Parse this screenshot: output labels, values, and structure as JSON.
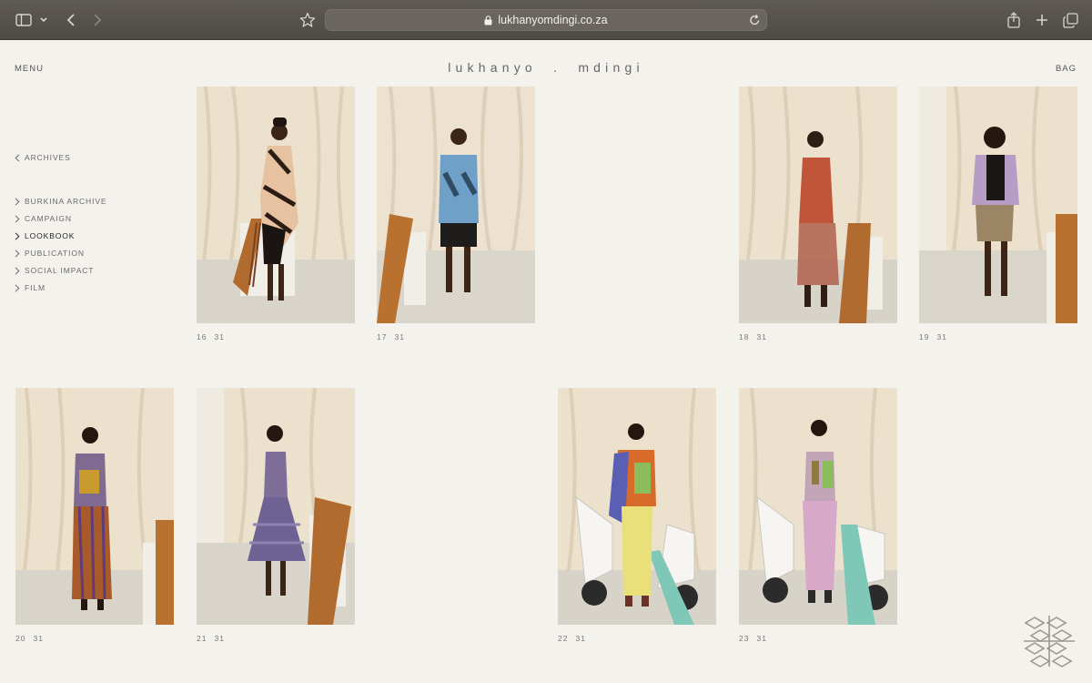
{
  "browser": {
    "url": "lukhanyomdingi.co.za"
  },
  "header": {
    "menu": "MENU",
    "logo": "lukhanyo  .  mdingi",
    "bag": "BAG"
  },
  "sidenav": {
    "back": "ARCHIVES",
    "items": [
      {
        "label": "BURKINA ARCHIVE"
      },
      {
        "label": "CAMPAIGN"
      },
      {
        "label": "LOOKBOOK",
        "active": true
      },
      {
        "label": "PUBLICATION"
      },
      {
        "label": "SOCIAL IMPACT"
      },
      {
        "label": "FILM"
      }
    ]
  },
  "gallery": {
    "total": "31",
    "looks": [
      {
        "number": "16",
        "total": "31",
        "outfit": "black-peach striped dress"
      },
      {
        "number": "17",
        "total": "31",
        "outfit": "blue mesh top, black shorts"
      },
      {
        "number": "18",
        "total": "31",
        "outfit": "rust mesh tank and skirt"
      },
      {
        "number": "19",
        "total": "31",
        "outfit": "lilac jacket, khaki shorts"
      },
      {
        "number": "20",
        "total": "31",
        "outfit": "patchwork panel look"
      },
      {
        "number": "21",
        "total": "31",
        "outfit": "purple striped dress"
      },
      {
        "number": "22",
        "total": "31",
        "outfit": "patchwork vest, yellow trousers, scooter"
      },
      {
        "number": "23",
        "total": "31",
        "outfit": "green mesh top, pink trousers, scooter"
      }
    ]
  },
  "colors": {
    "background": "#f4f2ec",
    "chrome": "#55504b",
    "curtain": "#ece2cf",
    "floor": "#d8d4cb"
  }
}
